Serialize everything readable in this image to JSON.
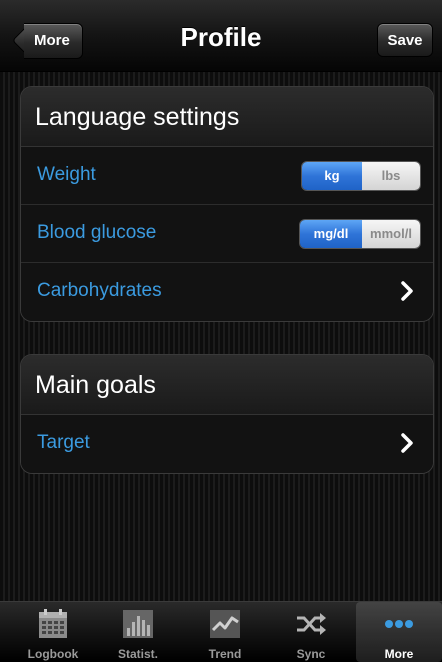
{
  "navbar": {
    "title": "Profile",
    "back_label": "More",
    "save_label": "Save"
  },
  "sections": [
    {
      "header": "Language settings",
      "rows": [
        {
          "label": "Weight",
          "control": "segmented",
          "options": [
            "kg",
            "lbs"
          ],
          "selected": "kg"
        },
        {
          "label": "Blood glucose",
          "control": "segmented",
          "options": [
            "mg/dl",
            "mmol/l"
          ],
          "selected": "mg/dl"
        },
        {
          "label": "Carbohydrates",
          "control": "disclosure",
          "icon": "chevron-right-icon"
        }
      ]
    },
    {
      "header": "Main goals",
      "rows": [
        {
          "label": "Target",
          "control": "disclosure",
          "icon": "chevron-right-icon"
        }
      ]
    }
  ],
  "tabbar": {
    "items": [
      {
        "label": "Logbook",
        "icon": "calendar-icon"
      },
      {
        "label": "Statist.",
        "icon": "bar-chart-icon"
      },
      {
        "label": "Trend",
        "icon": "trend-line-icon"
      },
      {
        "label": "Sync",
        "icon": "shuffle-icon"
      },
      {
        "label": "More",
        "icon": "more-dots-icon",
        "selected": true
      }
    ]
  },
  "colors": {
    "row_label": "#3b9be0",
    "segment_selected": "#2f74d8",
    "background": "#000000"
  }
}
